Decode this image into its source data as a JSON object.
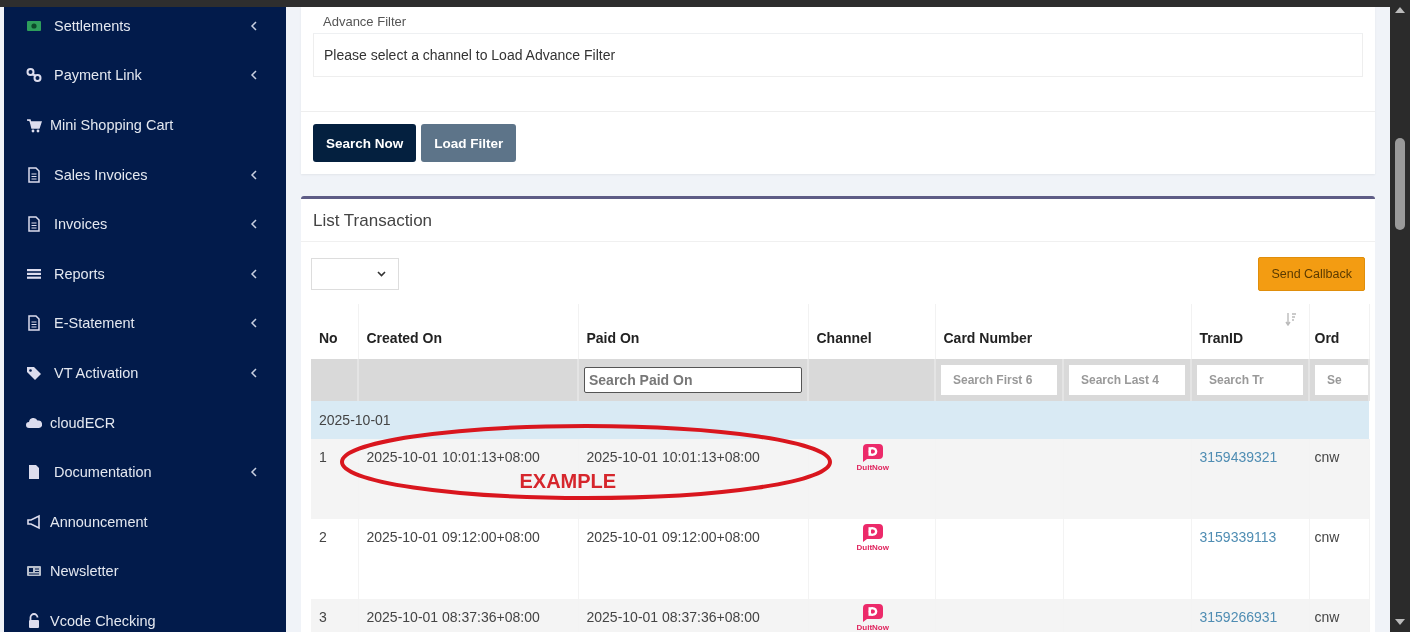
{
  "sidebar": {
    "items": [
      {
        "label": "Settlements",
        "has_submenu": true
      },
      {
        "label": "Payment Link",
        "has_submenu": true
      },
      {
        "label": "Mini Shopping Cart",
        "has_submenu": false
      },
      {
        "label": "Sales Invoices",
        "has_submenu": true
      },
      {
        "label": "Invoices",
        "has_submenu": true
      },
      {
        "label": "Reports",
        "has_submenu": true
      },
      {
        "label": "E-Statement",
        "has_submenu": true
      },
      {
        "label": "VT Activation",
        "has_submenu": true
      },
      {
        "label": "cloudECR",
        "has_submenu": false
      },
      {
        "label": "Documentation",
        "has_submenu": true
      },
      {
        "label": "Announcement",
        "has_submenu": false
      },
      {
        "label": "Newsletter",
        "has_submenu": false
      },
      {
        "label": "Vcode Checking",
        "has_submenu": false
      }
    ]
  },
  "filter_panel": {
    "title": "Advance Filter",
    "message": "Please select a channel to Load Advance Filter",
    "buttons": [
      {
        "label": "Search Now",
        "kind": "primary"
      },
      {
        "label": "Load Filter",
        "kind": "secondary"
      }
    ]
  },
  "transactions": {
    "title": "List Transaction",
    "send_callback": "Send Callback",
    "table": {
      "columns": [
        "No",
        "Created On",
        "Paid On",
        "Channel",
        "Card Number",
        "TranID",
        "Ord"
      ],
      "filters": [
        {
          "placeholder": "Search Paid On",
          "kind": "outlined"
        },
        {
          "placeholder": "Search First 6",
          "kind": "plain"
        },
        {
          "placeholder": "Search Last 4",
          "kind": "plain"
        },
        {
          "placeholder": "Search Tr",
          "kind": "plain"
        },
        {
          "placeholder": "Se",
          "kind": "plain"
        }
      ],
      "group": "2025-10-01",
      "rows": [
        {
          "no": "1",
          "created_on": "2025-10-01 10:01:13+08:00",
          "paid_on": "2025-10-01 10:01:13+08:00",
          "channel": "DuitNow",
          "tran_id": "3159439321",
          "order": "cnw"
        },
        {
          "no": "2",
          "created_on": "2025-10-01 09:12:00+08:00",
          "paid_on": "2025-10-01 09:12:00+08:00",
          "channel": "DuitNow",
          "tran_id": "3159339113",
          "order": "cnw"
        },
        {
          "no": "3",
          "created_on": "2025-10-01 08:37:36+08:00",
          "paid_on": "2025-10-01 08:37:36+08:00",
          "channel": "DuitNow",
          "tran_id": "3159266931",
          "order": "cnw"
        }
      ]
    }
  },
  "annotation": {
    "label": "EXAMPLE"
  }
}
